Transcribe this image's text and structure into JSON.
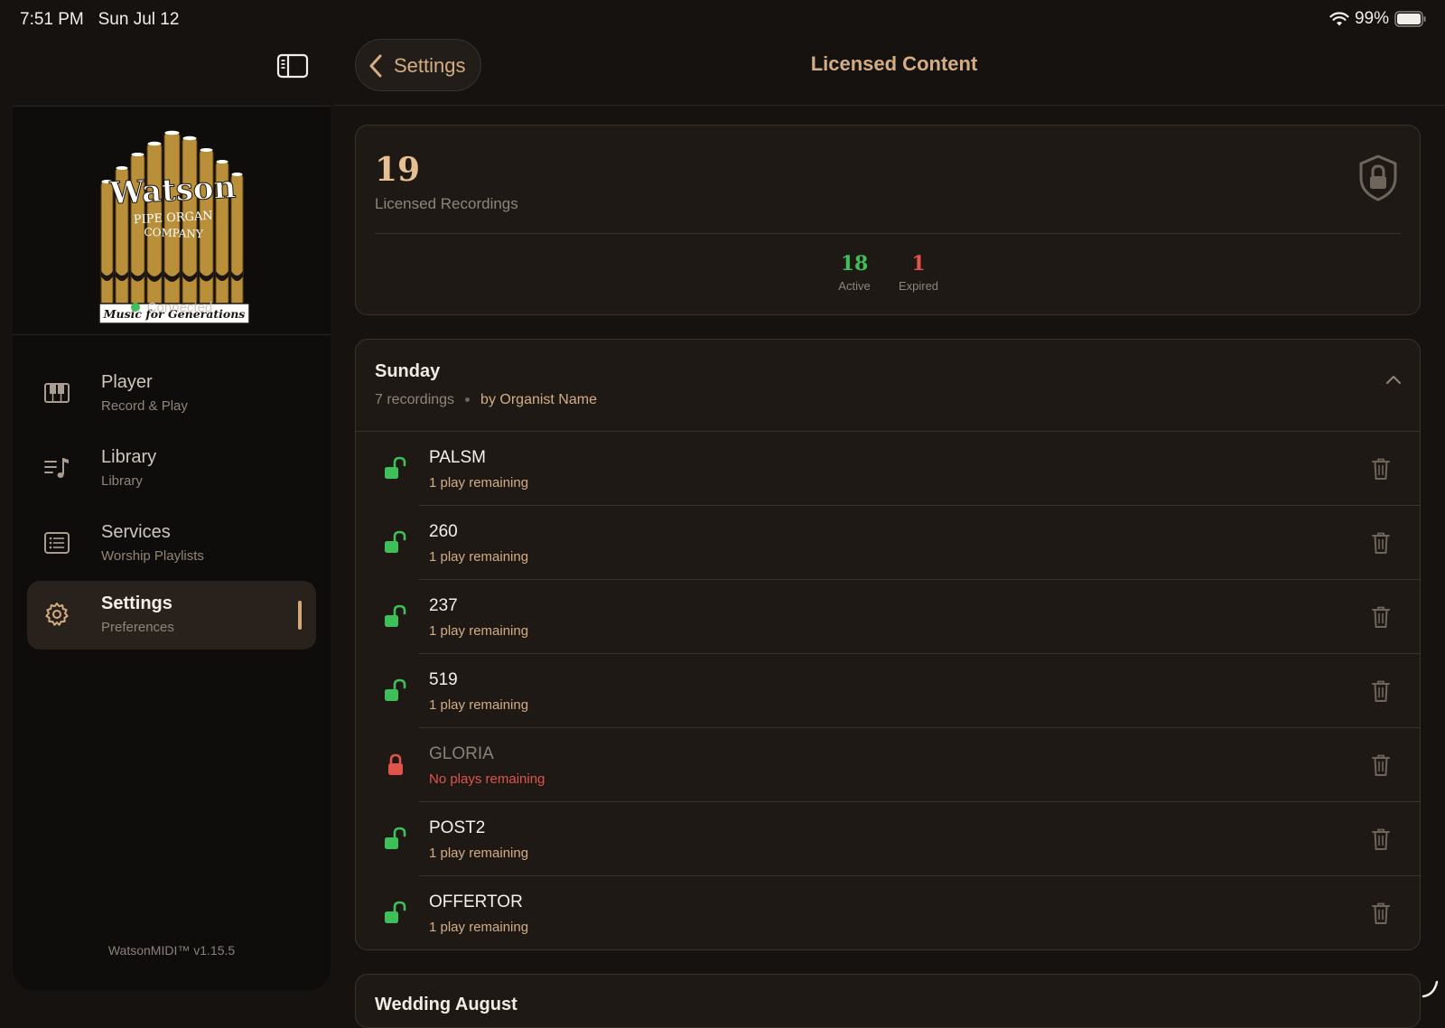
{
  "status": {
    "time": "7:51 PM",
    "date": "Sun Jul 12",
    "battery": "99%"
  },
  "sidebar": {
    "connection": "Connected",
    "items": [
      {
        "title": "Player",
        "subtitle": "Record & Play",
        "icon": "piano-icon"
      },
      {
        "title": "Library",
        "subtitle": "Library",
        "icon": "music-list-icon"
      },
      {
        "title": "Services",
        "subtitle": "Worship Playlists",
        "icon": "list-box-icon"
      },
      {
        "title": "Settings",
        "subtitle": "Preferences",
        "icon": "gear-icon"
      }
    ],
    "version": "WatsonMIDI™ v1.15.5"
  },
  "logo": {
    "name": "Watson",
    "line1": "PIPE ORGAN",
    "line2": "COMPANY",
    "tagline": "Music for Generations"
  },
  "header": {
    "back_label": "Settings",
    "title": "Licensed Content"
  },
  "summary": {
    "total": "19",
    "total_label": "Licensed Recordings",
    "active": "18",
    "active_label": "Active",
    "expired": "1",
    "expired_label": "Expired"
  },
  "group": {
    "title": "Sunday",
    "count": "7 recordings",
    "by": "by Organist Name",
    "rows": [
      {
        "title": "PALSM",
        "sub": "1 play remaining",
        "expired": false
      },
      {
        "title": "260",
        "sub": "1 play remaining",
        "expired": false
      },
      {
        "title": "237",
        "sub": "1 play remaining",
        "expired": false
      },
      {
        "title": "519",
        "sub": "1 play remaining",
        "expired": false
      },
      {
        "title": "GLORIA",
        "sub": "No plays remaining",
        "expired": true
      },
      {
        "title": "POST2",
        "sub": "1 play remaining",
        "expired": false
      },
      {
        "title": "OFFERTOR",
        "sub": "1 play remaining",
        "expired": false
      }
    ]
  },
  "next_group": {
    "title": "Wedding August"
  },
  "colors": {
    "accent": "#d4ad84",
    "active": "#3fbf5a",
    "expired": "#e0544b",
    "background": "#151210"
  }
}
